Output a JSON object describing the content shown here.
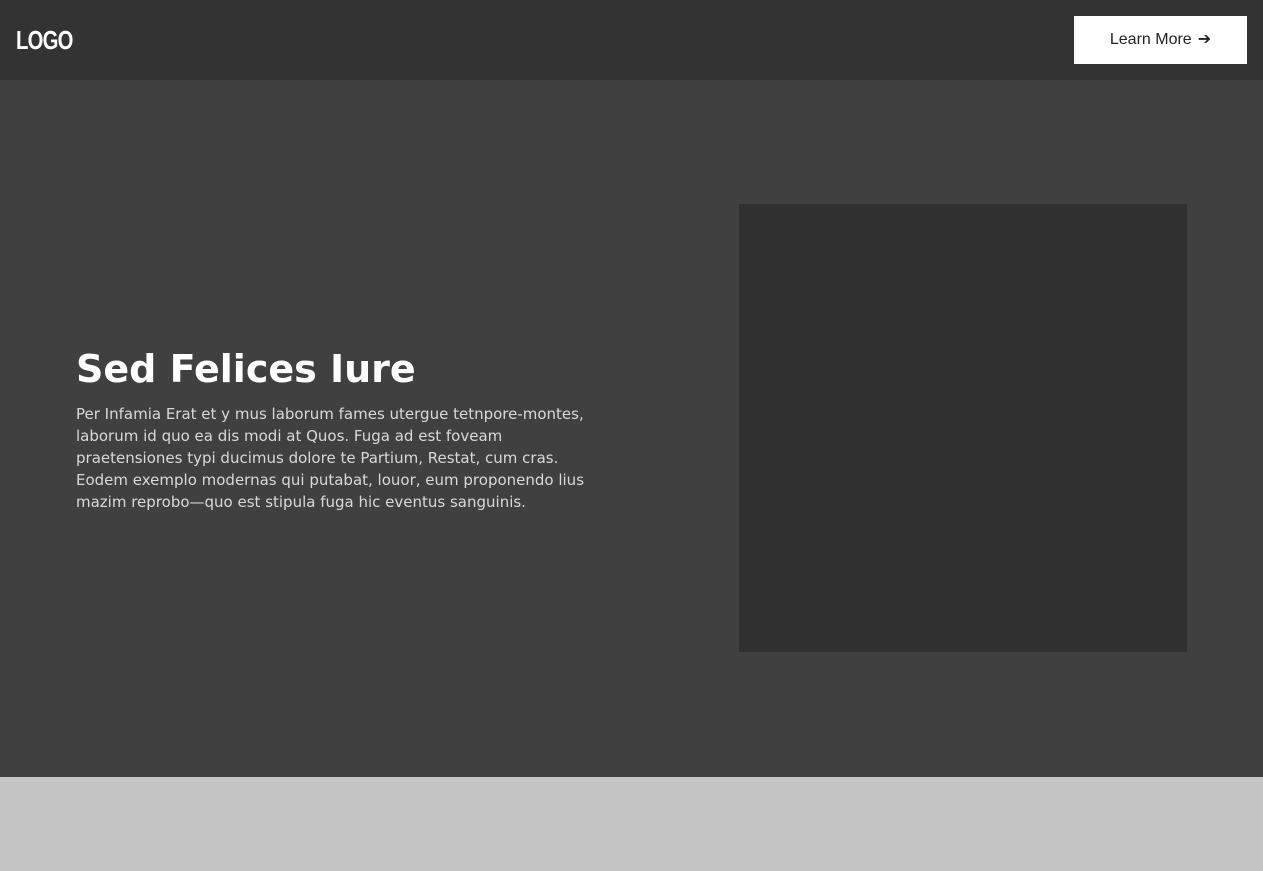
{
  "header": {
    "logo_text": "LOGO",
    "cta_label": "Learn More",
    "cta_icon": "arrow-right-icon",
    "cta_arrow": "➔"
  },
  "hero": {
    "title": "Sed Felices Iure",
    "body": "Per Infamia Erat et y mus laborum fames utergue tetnpore-montes, laborum id quo ea dis modi at Quos. Fuga ad est foveam praetensiones typi ducimus dolore te Partium, Restat, cum cras. Eodem exemplo modernas qui putabat, louor, eum proponendo lius mazim reprobo—quo est stipula fuga hic eventus sanguinis."
  },
  "colors": {
    "header_bg": "#333333",
    "hero_bg": "#404040",
    "media_placeholder": "#303030",
    "footer_bg": "#c4c4c4",
    "cta_bg": "#ffffff"
  }
}
